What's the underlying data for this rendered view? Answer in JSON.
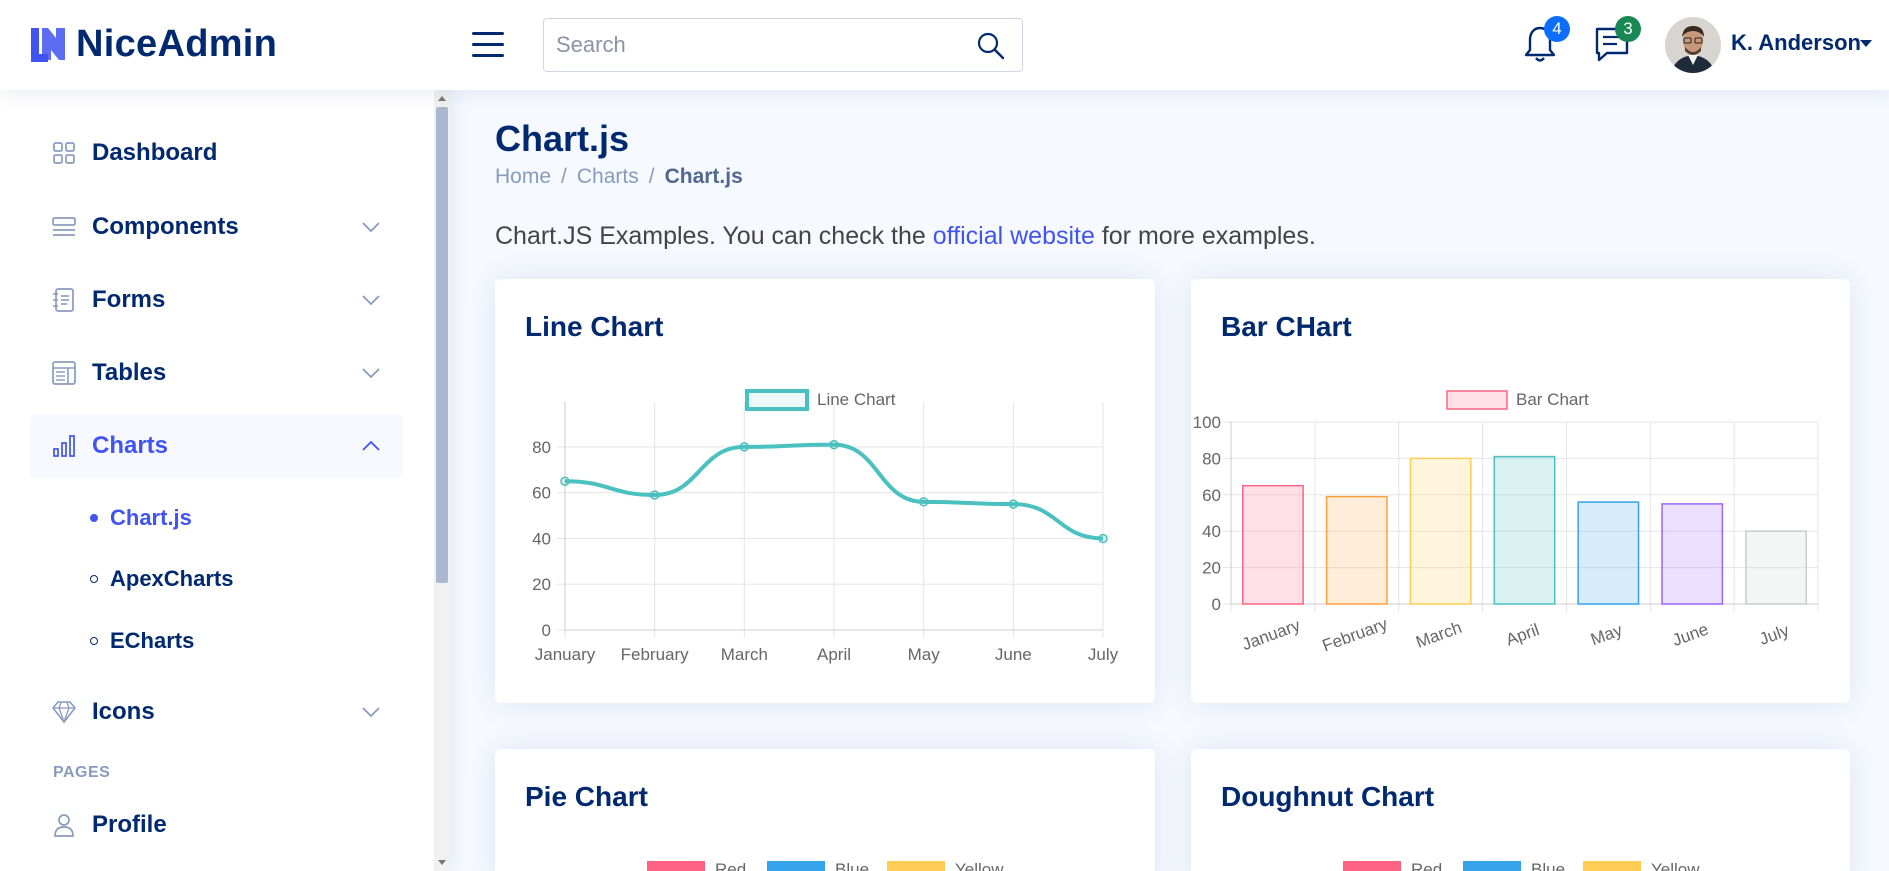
{
  "header": {
    "logo_text": "NiceAdmin",
    "search_placeholder": "Search",
    "notifications_count": "4",
    "messages_count": "3",
    "user_name": "K. Anderson"
  },
  "sidebar": {
    "items": [
      {
        "label": "Dashboard",
        "icon": "grid-icon"
      },
      {
        "label": "Components",
        "icon": "menu-button-icon"
      },
      {
        "label": "Forms",
        "icon": "journal-text-icon"
      },
      {
        "label": "Tables",
        "icon": "layout-text-window-icon"
      },
      {
        "label": "Charts",
        "icon": "bar-chart-icon"
      },
      {
        "label": "Icons",
        "icon": "gem-icon"
      }
    ],
    "chart_subitems": [
      {
        "label": "Chart.js"
      },
      {
        "label": "ApexCharts"
      },
      {
        "label": "ECharts"
      }
    ],
    "pages_heading": "PAGES",
    "profile_label": "Profile"
  },
  "main": {
    "title": "Chart.js",
    "breadcrumb": [
      "Home",
      "Charts",
      "Chart.js"
    ],
    "intro_before": "Chart.JS Examples. You can check the ",
    "intro_link": "official website",
    "intro_after": " for more examples."
  },
  "colors": {
    "primary": "#4154f1",
    "navy": "#012970",
    "notif_badge": "#0d6efd",
    "msg_badge": "#198754"
  },
  "chart_data": [
    {
      "type": "line",
      "title": "Line Chart",
      "legend": "Line Chart",
      "categories": [
        "January",
        "February",
        "March",
        "April",
        "May",
        "June",
        "July"
      ],
      "values": [
        65,
        59,
        80,
        81,
        56,
        55,
        40
      ],
      "ylim": [
        0,
        90
      ],
      "yticks": [
        0,
        20,
        40,
        60,
        80
      ],
      "color": "#4bc0c0",
      "grid": true,
      "legend_position": "top"
    },
    {
      "type": "bar",
      "title": "Bar CHart",
      "legend": "Bar Chart",
      "categories": [
        "January",
        "February",
        "March",
        "April",
        "May",
        "June",
        "July"
      ],
      "values": [
        65,
        59,
        80,
        81,
        56,
        55,
        40
      ],
      "ylim": [
        0,
        100
      ],
      "yticks": [
        0,
        20,
        40,
        60,
        80,
        100
      ],
      "bar_colors": [
        "#ff6384",
        "#ff9f40",
        "#ffcd56",
        "#4bc0c0",
        "#36a2eb",
        "#9966ff",
        "#c9cbcf"
      ],
      "grid": true,
      "legend_position": "top"
    },
    {
      "type": "pie",
      "title": "Pie Chart",
      "legend": [
        "Red",
        "Blue",
        "Yellow"
      ],
      "colors": [
        "#ff6384",
        "#36a2eb",
        "#ffcd56"
      ],
      "legend_position": "top"
    },
    {
      "type": "pie",
      "title": "Doughnut Chart",
      "legend": [
        "Red",
        "Blue",
        "Yellow"
      ],
      "colors": [
        "#ff6384",
        "#36a2eb",
        "#ffcd56"
      ],
      "legend_position": "top"
    }
  ]
}
